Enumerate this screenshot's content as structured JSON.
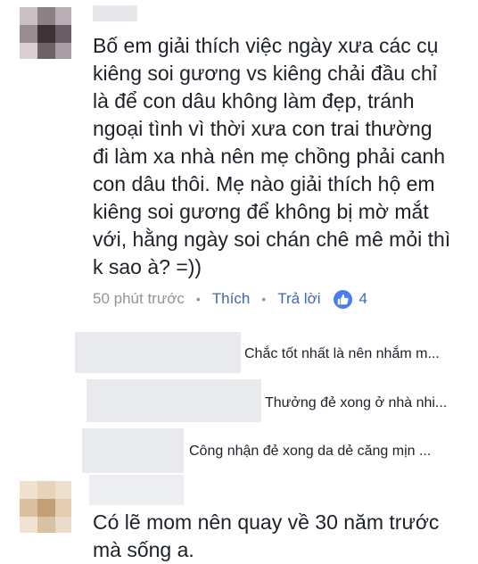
{
  "comment": {
    "lines": [
      "Bố em giải thích việc ngày xưa các cụ",
      "kiêng soi gương vs kiêng chải đầu chỉ",
      "là để con dâu không làm đẹp, tránh",
      "ngoại tình vì thời xưa con trai thường",
      "đi làm xa nhà nên mẹ chồng phải canh",
      "con dâu thôi. Mẹ nào giải thích hộ em",
      "kiêng soi gương để không bị mờ mắt",
      "với, hằng ngày soi chán chê mê mỏi thì",
      "k sao à? =))"
    ],
    "actions": {
      "time": "50 phút trước",
      "separator": "•",
      "like_label": "Thích",
      "reply_label": "Trả lời",
      "like_count": "4",
      "like_icon_color": "#4a7ef0"
    }
  },
  "replies": [
    {
      "text": "Chắc tốt nhất là nên nhắm m..."
    },
    {
      "text": "Thưởng đẻ xong ở nhà nhi..."
    },
    {
      "text": "Công nhận đẻ xong da dẻ căng mịn ..."
    }
  ],
  "last_comment": {
    "lines": [
      "Có lẽ mom nên quay về 30 năm trước",
      "mà sống a."
    ]
  },
  "colors": {
    "text": "#1d2129",
    "muted": "#90949c",
    "link": "#4267b2",
    "blur": "#e9eaed"
  }
}
